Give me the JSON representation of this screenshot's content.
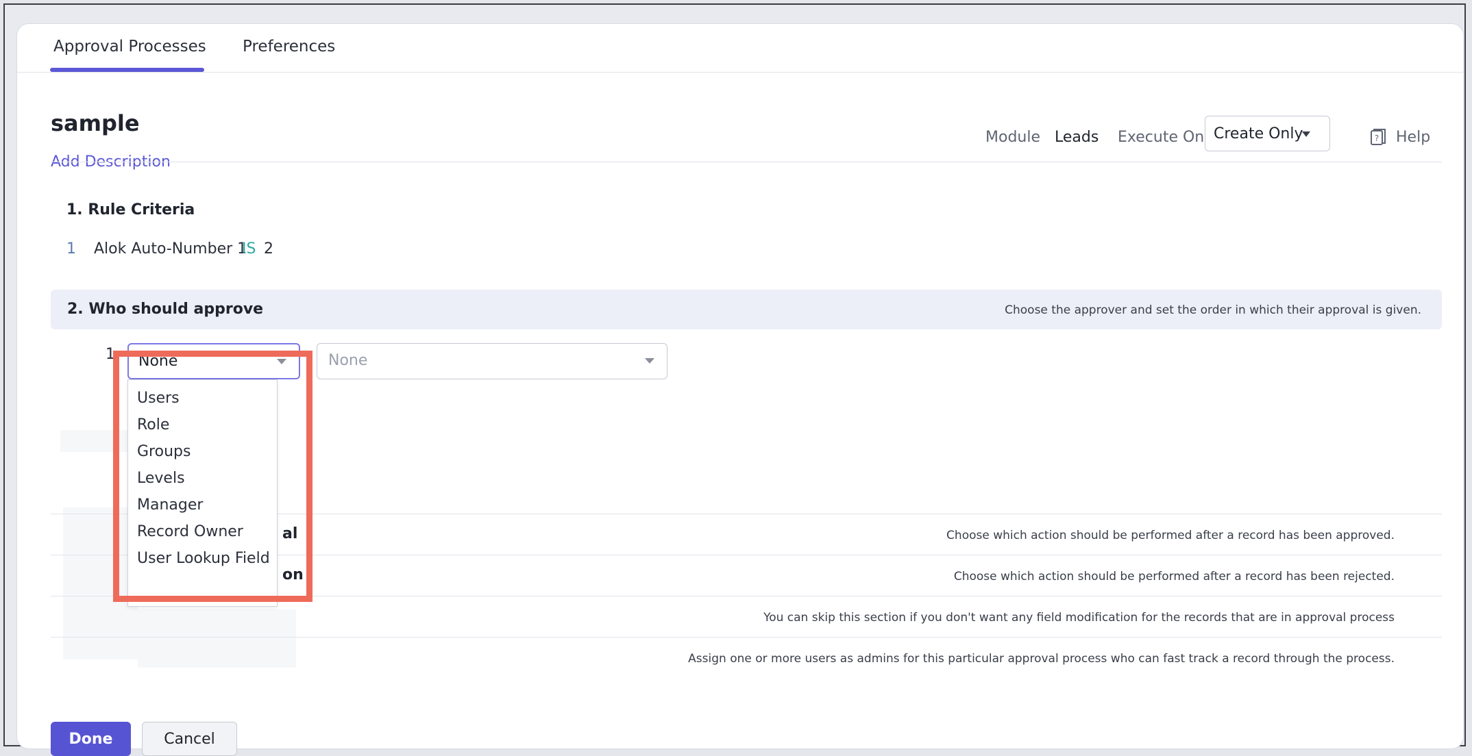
{
  "tabs": [
    {
      "label": "Approval Processes",
      "active": true
    },
    {
      "label": "Preferences",
      "active": false
    }
  ],
  "header": {
    "title": "sample",
    "add_description": "Add Description",
    "module_label": "Module",
    "module_value": "Leads",
    "execute_on_label": "Execute On",
    "execute_on_value": "Create Only",
    "help_label": "Help"
  },
  "rule_criteria": {
    "title": "1.  Rule Criteria",
    "items": [
      {
        "number": "1",
        "field": "Alok Auto-Number 1",
        "operator": "IS",
        "value": "2"
      }
    ]
  },
  "who_should_approve": {
    "title": "2.  Who should approve",
    "description": "Choose the approver and set the order in which their approval is given.",
    "row_number": "1",
    "approver_type_value": "None",
    "approver_value_placeholder": "None",
    "dropdown_options": [
      "Users",
      "Role",
      "Groups",
      "Levels",
      "Manager",
      "Record Owner",
      "User Lookup Field"
    ]
  },
  "sections": [
    {
      "label_fragment": "al",
      "description": "Choose which action should be performed after a record has been approved."
    },
    {
      "label_fragment": "on",
      "description": "Choose which action should be performed after a record has been rejected."
    },
    {
      "label_fragment": "",
      "description": "You can skip this section if you don't want any field modification for the records that are in approval process"
    },
    {
      "label_fragment": "",
      "description": "Assign one or more users as admins for this particular approval process who can fast track a record through the process."
    }
  ],
  "footer": {
    "done_label": "Done",
    "cancel_label": "Cancel"
  },
  "colors": {
    "accent": "#5b57d6",
    "highlight": "#ee6b5a",
    "operator": "#2fa8a0"
  }
}
